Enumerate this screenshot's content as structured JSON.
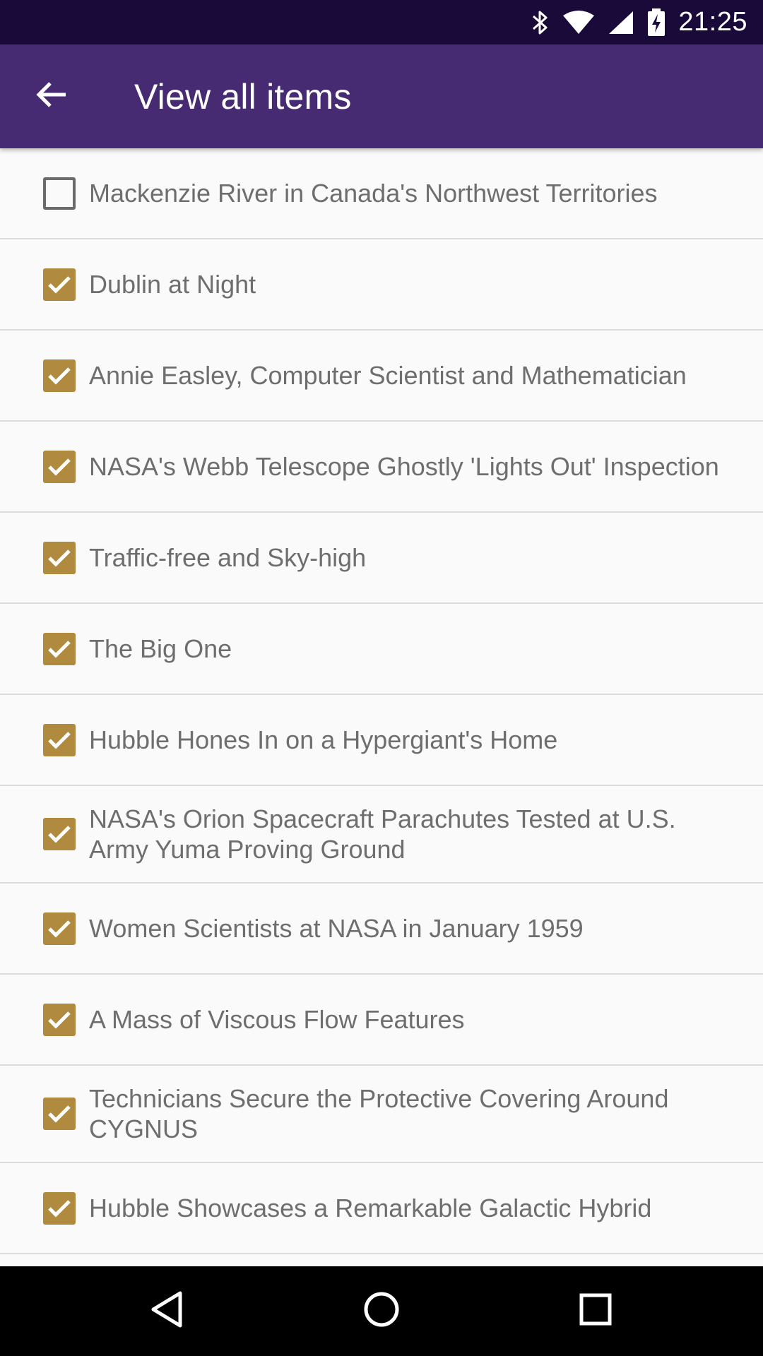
{
  "status_bar": {
    "time": "21:25",
    "icons": [
      "bluetooth-icon",
      "wifi-icon",
      "signal-icon",
      "battery-charging-icon"
    ]
  },
  "app_bar": {
    "title": "View all items",
    "back_icon": "arrow-back-icon"
  },
  "colors": {
    "status_bar": "#1a0a3a",
    "app_bar": "#462b73",
    "checkbox_checked": "#b08a3e",
    "checkbox_unchecked_border": "#6b6b6b",
    "divider": "#dcdcdc",
    "label": "#6e6e6e"
  },
  "items": [
    {
      "label": "Mackenzie River in Canada's Northwest Territories",
      "checked": false
    },
    {
      "label": "Dublin at Night",
      "checked": true
    },
    {
      "label": "Annie Easley, Computer Scientist and Mathematician",
      "checked": true
    },
    {
      "label": "NASA's Webb Telescope Ghostly 'Lights Out' Inspection",
      "checked": true
    },
    {
      "label": "Traffic-free and Sky-high",
      "checked": true
    },
    {
      "label": "The Big One",
      "checked": true
    },
    {
      "label": "Hubble Hones In on a Hypergiant's Home",
      "checked": true
    },
    {
      "label": "NASA's Orion Spacecraft Parachutes Tested at U.S. Army Yuma Proving Ground",
      "checked": true
    },
    {
      "label": "Women Scientists at NASA in January 1959",
      "checked": true
    },
    {
      "label": "A Mass of Viscous Flow Features",
      "checked": true
    },
    {
      "label": "Technicians Secure the Protective Covering Around CYGNUS",
      "checked": true
    },
    {
      "label": "Hubble Showcases a Remarkable Galactic Hybrid",
      "checked": true
    }
  ],
  "nav_bar": {
    "icons": [
      "back-triangle-icon",
      "home-circle-icon",
      "recents-square-icon"
    ]
  }
}
